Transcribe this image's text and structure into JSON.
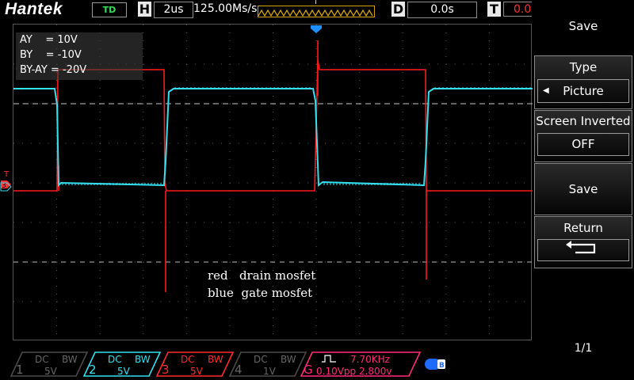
{
  "topbar": {
    "brand": "Hantek",
    "mode": "TD",
    "h_letter": "H",
    "timebase": "2us",
    "sample_rate": "125.00Ms/s",
    "trigger_marker": "T",
    "d_letter": "D",
    "delay": "0.0s",
    "t_letter": "T",
    "trig_level": "0.0"
  },
  "measurements": [
    "AY    = 10V",
    "BY    = -10V",
    "BY-AY = -20V"
  ],
  "annotation": {
    "line1": "red   drain mosfet",
    "line2": "blue  gate mosfet"
  },
  "sidebar": {
    "title": "Save",
    "type_label": "Type",
    "type_value": "Picture",
    "screen_inverted_label": "Screen Inverted",
    "screen_inverted_value": "OFF",
    "save_button": "Save",
    "return_label": "Return",
    "page": "1/1"
  },
  "channels": [
    {
      "num": "1",
      "coupling": "DC",
      "bw": "BW",
      "scale": "5V",
      "color": "#4a4a4a"
    },
    {
      "num": "2",
      "coupling": "DC",
      "bw": "BW",
      "scale": "5V",
      "color": "#33e0f0"
    },
    {
      "num": "3",
      "coupling": "DC",
      "bw": "BW",
      "scale": "5V",
      "color": "#ff2a2a"
    },
    {
      "num": "4",
      "coupling": "DC",
      "bw": "BW",
      "scale": "1V",
      "color": "#4a4a4a"
    }
  ],
  "generator": {
    "letter": "G",
    "freq": "7.70KHz",
    "amplitude": "0.10Vpp 2.800v",
    "color": "#ff2a7a"
  },
  "colors": {
    "ch2_trace": "#33e0f0",
    "ch3_trace": "#ff1a1a",
    "trigger_marker": "#1e90ff",
    "trigger_strip": "#d4a400"
  }
}
